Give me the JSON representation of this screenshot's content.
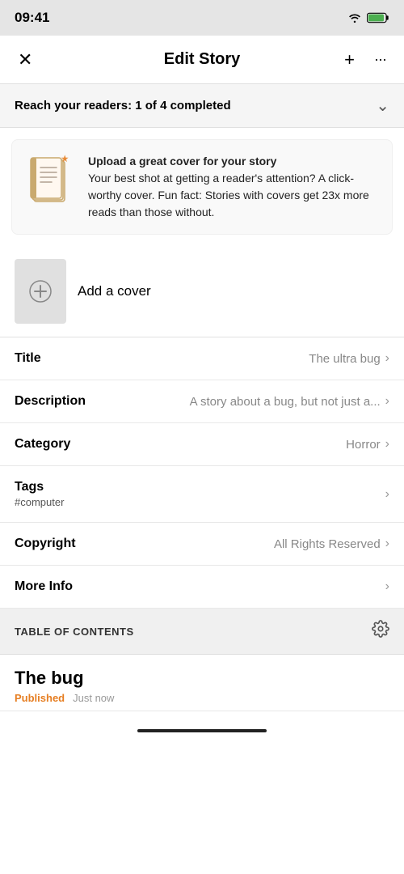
{
  "statusBar": {
    "time": "09:41",
    "wifi": "📶",
    "battery": "🔋"
  },
  "header": {
    "title": "Edit Story",
    "closeIcon": "✕",
    "addIcon": "+",
    "moreIcon": "···"
  },
  "reachBanner": {
    "label": "Reach your readers:",
    "progress": "1 of 4 completed",
    "chevron": "⌄"
  },
  "infoCard": {
    "text": "Upload a great cover for your story\nYour best shot at getting a reader's attention? A click-worthy cover. Fun fact: Stories with covers get 23x more reads than those without."
  },
  "coverSection": {
    "addLabel": "Add a cover"
  },
  "rows": [
    {
      "label": "Title",
      "value": "The ultra bug",
      "hasChevron": true
    },
    {
      "label": "Description",
      "value": "A story about a bug, but not just a...",
      "hasChevron": true
    },
    {
      "label": "Category",
      "value": "Horror",
      "hasChevron": true
    },
    {
      "label": "Tags",
      "sublabel": "#computer",
      "value": "",
      "hasChevron": true
    },
    {
      "label": "Copyright",
      "value": "All Rights Reserved",
      "hasChevron": true
    },
    {
      "label": "More Info",
      "value": "",
      "hasChevron": true
    }
  ],
  "tableOfContents": {
    "label": "TABLE OF CONTENTS"
  },
  "storyItem": {
    "title": "The bug",
    "status": "Published",
    "time": "Just now"
  }
}
